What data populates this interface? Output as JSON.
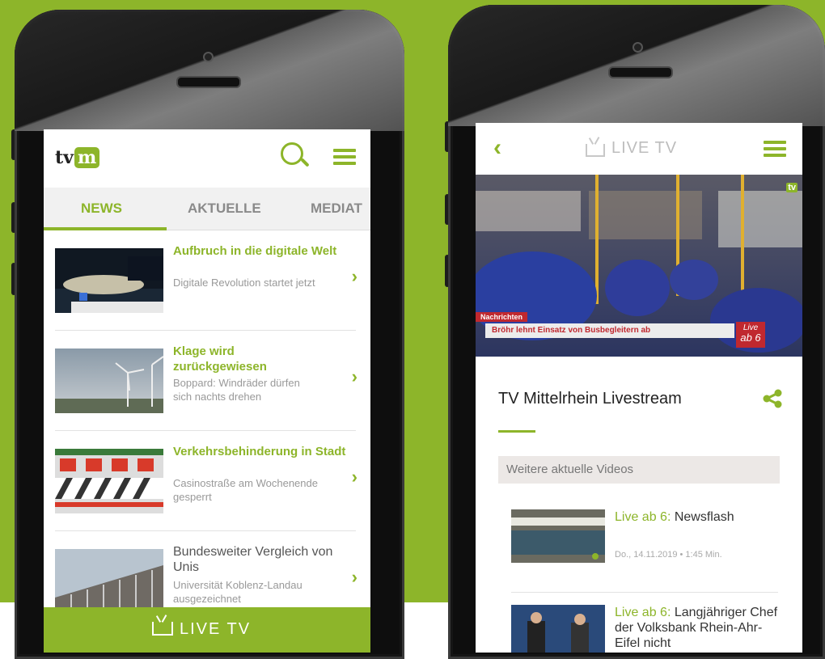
{
  "colors": {
    "brand_green": "#8db52a",
    "ticker_red": "#c0282f"
  },
  "left_phone": {
    "logo_tv": "tv",
    "logo_m": "m",
    "tabs": [
      {
        "label": "NEWS"
      },
      {
        "label": "AKTUELLE"
      },
      {
        "label": "MEDIAT"
      }
    ],
    "news": [
      {
        "title": "Aufbruch in die digitale Welt",
        "subtitle": "Digitale Revolution startet jetzt"
      },
      {
        "title": "Klage wird zurückgewiesen",
        "subtitle": "Boppard: Windräder dürfen sich nachts drehen"
      },
      {
        "title": "Verkehrsbehinderung in Stadt",
        "subtitle": "Casinostraße am Wochenende gesperrt"
      },
      {
        "title": "Bundesweiter Vergleich von Unis",
        "subtitle": "Universität Koblenz-Landau ausgezeichnet"
      }
    ],
    "live_label": "LIVE TV"
  },
  "right_phone": {
    "header_label": "LIVE TV",
    "video": {
      "badge": "Nachrichten",
      "ticker": "Bröhr lehnt Einsatz von Busbegleitern ab",
      "live_badge_1": "Live",
      "live_badge_2": "ab 6",
      "logo": "tv"
    },
    "stream_title": "TV Mittelrhein Livestream",
    "section_title": "Weitere aktuelle Videos",
    "videos": [
      {
        "prefix": "Live ab 6:",
        "title": " Newsflash",
        "meta": "Do., 14.11.2019  •  1:45 Min."
      },
      {
        "prefix": "Live ab 6:",
        "title": " Langjähriger Chef der Volksbank Rhein-Ahr-Eifel nicht",
        "meta": ""
      }
    ]
  }
}
